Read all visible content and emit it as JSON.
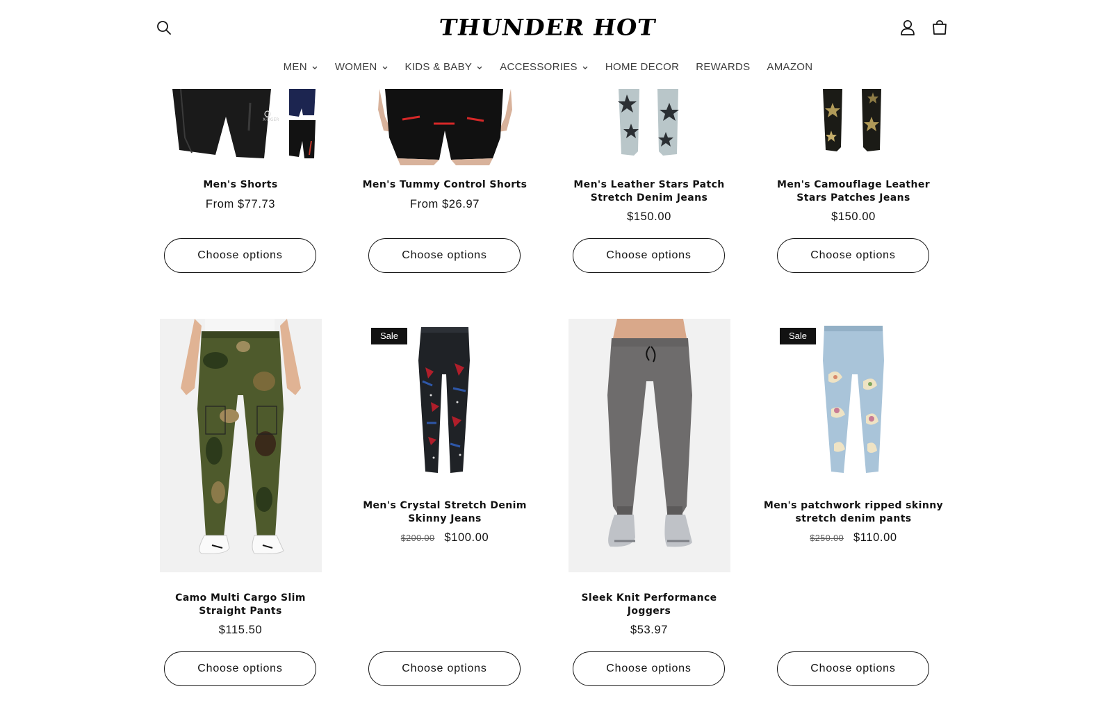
{
  "header": {
    "logo_text": "THUNDER HOT",
    "icons": {
      "search": "search-icon",
      "account": "account-icon",
      "cart": "cart-icon"
    }
  },
  "nav": [
    {
      "label": "MEN",
      "has_dropdown": true
    },
    {
      "label": "WOMEN",
      "has_dropdown": true
    },
    {
      "label": "KIDS & BABY",
      "has_dropdown": true
    },
    {
      "label": "ACCESSORIES",
      "has_dropdown": true
    },
    {
      "label": "HOME DECOR",
      "has_dropdown": false
    },
    {
      "label": "REWARDS",
      "has_dropdown": false
    },
    {
      "label": "AMAZON",
      "has_dropdown": false
    }
  ],
  "products": [
    {
      "title": "Men's Shorts",
      "price": "From $77.73",
      "button": "Choose options"
    },
    {
      "title": "Men's Tummy Control Shorts",
      "price": "From $26.97",
      "button": "Choose options"
    },
    {
      "title": "Men's Leather Stars Patch Stretch Denim Jeans",
      "price": "$150.00",
      "button": "Choose options"
    },
    {
      "title": "Men's Camouflage Leather Stars Patches Jeans",
      "price": "$150.00",
      "button": "Choose options"
    },
    {
      "title": "Camo Multi Cargo Slim Straight Pants",
      "price": "$115.50",
      "button": "Choose options"
    },
    {
      "title": "Men's Crystal Stretch Denim Skinny Jeans",
      "badge": "Sale",
      "compare_price": "$200.00",
      "price": "$100.00",
      "button": "Choose options"
    },
    {
      "title": "Sleek Knit Performance Joggers",
      "price": "$53.97",
      "button": "Choose options"
    },
    {
      "title": "Men's patchwork ripped skinny stretch denim pants",
      "badge": "Sale",
      "compare_price": "$250.00",
      "price": "$110.00",
      "button": "Choose options"
    }
  ],
  "colors": {
    "text": "#121212",
    "badge_bg": "#121212",
    "image_bg": "#f1f1f1"
  }
}
